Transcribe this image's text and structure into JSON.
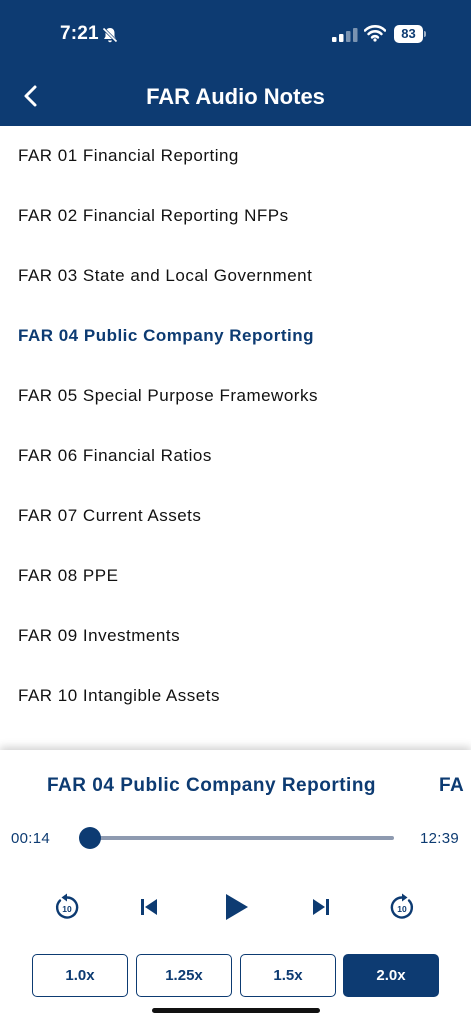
{
  "status": {
    "time": "7:21",
    "battery": "83",
    "icons": [
      "bell-slash-icon",
      "signal-icon",
      "wifi-icon",
      "battery-icon"
    ]
  },
  "nav": {
    "title": "FAR Audio Notes",
    "back_icon": "chevron-left-icon"
  },
  "list": {
    "items": [
      {
        "label": "FAR 01 Financial Reporting",
        "active": false
      },
      {
        "label": "FAR 02 Financial Reporting NFPs",
        "active": false
      },
      {
        "label": "FAR 03 State and Local Government",
        "active": false
      },
      {
        "label": "FAR 04 Public Company Reporting",
        "active": true
      },
      {
        "label": "FAR 05 Special Purpose Frameworks",
        "active": false
      },
      {
        "label": "FAR 06 Financial Ratios",
        "active": false
      },
      {
        "label": "FAR 07 Current Assets",
        "active": false
      },
      {
        "label": "FAR 08 PPE",
        "active": false
      },
      {
        "label": "FAR 09 Investments",
        "active": false
      },
      {
        "label": "FAR 10 Intangible Assets",
        "active": false
      }
    ]
  },
  "player": {
    "now_playing": "FAR 04 Public Company Reporting",
    "next_partial": "FA",
    "current_time": "00:14",
    "total_time": "12:39",
    "progress": 0.018,
    "controls": {
      "rewind_icon": "rewind-10-icon",
      "rewind_seconds": "10",
      "previous_icon": "skip-previous-icon",
      "play_icon": "play-icon",
      "next_icon": "skip-next-icon",
      "forward_icon": "forward-10-icon",
      "forward_seconds": "10"
    },
    "speeds": [
      {
        "label": "1.0x",
        "selected": false
      },
      {
        "label": "1.25x",
        "selected": false
      },
      {
        "label": "1.5x",
        "selected": false
      },
      {
        "label": "2.0x",
        "selected": true
      }
    ]
  },
  "colors": {
    "brand": "#0d3b72",
    "text": "#111111",
    "track": "#8e9ab0",
    "background": "#ffffff"
  }
}
